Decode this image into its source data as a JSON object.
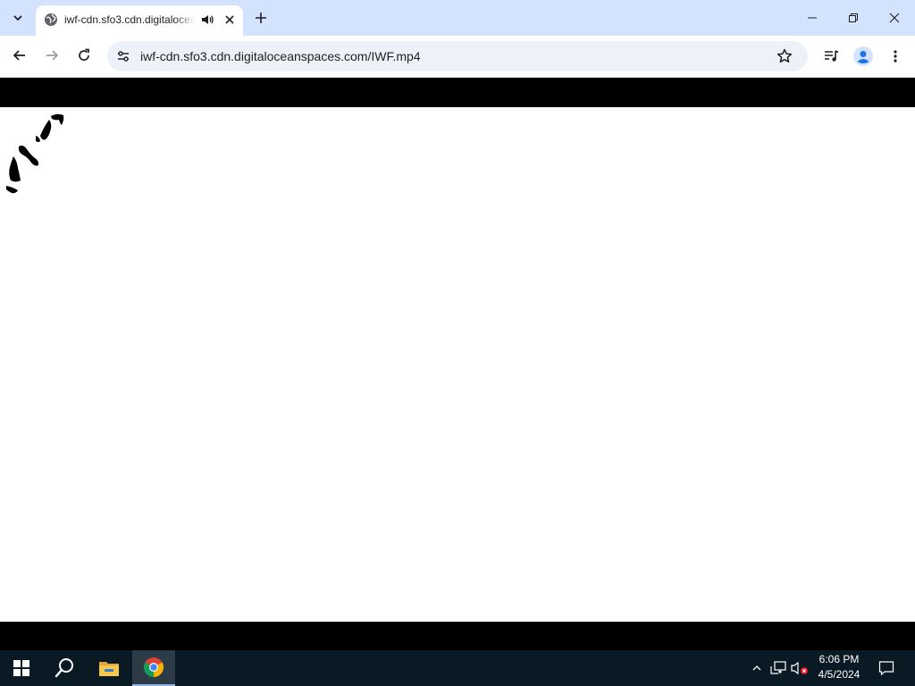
{
  "browser": {
    "tab": {
      "title": "iwf-cdn.sfo3.cdn.digitaloceanspaces.com/IWF.mp4",
      "favicon": "globe-icon",
      "audio_icon": "speaker-icon"
    },
    "omnibox": {
      "url": "iwf-cdn.sfo3.cdn.digitaloceanspaces.com/IWF.mp4"
    },
    "colors": {
      "tabstrip": "#d3e3fd",
      "omnibox_bg": "#edf2fa",
      "profile_blue": "#1a73e8"
    }
  },
  "taskbar": {
    "apps": [
      "windows-start-icon",
      "search-icon",
      "file-explorer-icon",
      "chrome-icon"
    ],
    "clock": {
      "time": "6:06 PM",
      "date": "4/5/2024"
    },
    "colors": {
      "background": "#0a1a24"
    }
  }
}
